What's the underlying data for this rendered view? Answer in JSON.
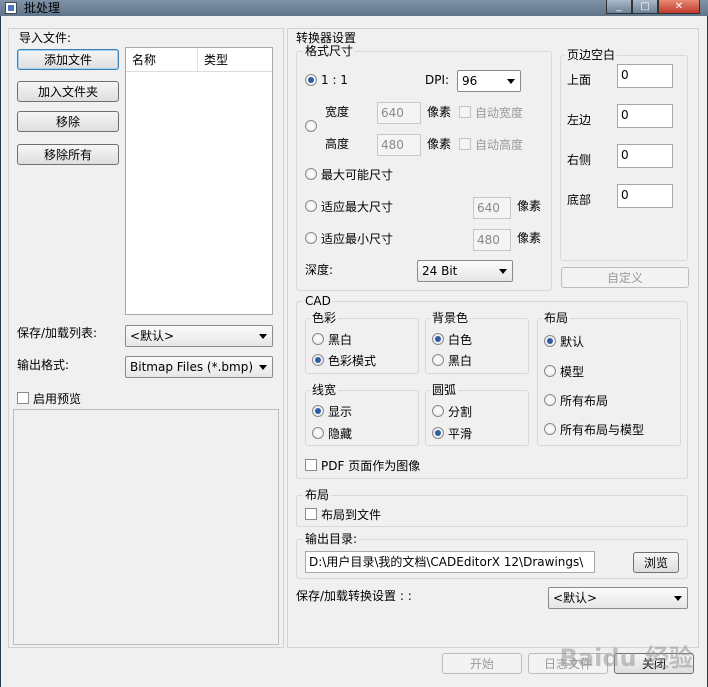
{
  "window": {
    "title": "批处理",
    "minimize": "_",
    "maximize": "□",
    "close": "✕"
  },
  "import": {
    "group_label": "导入文件:",
    "add_file": "添加文件",
    "add_folder": "加入文件夹",
    "remove": "移除",
    "remove_all": "移除所有",
    "columns": [
      "名称",
      "类型"
    ]
  },
  "save_load_list": {
    "label": "保存/加载列表:",
    "value": "<默认>"
  },
  "output_format": {
    "label": "输出格式:",
    "value": "Bitmap Files (*.bmp)"
  },
  "preview": {
    "label": "启用预览"
  },
  "converter": {
    "group_label": "转换器设置",
    "format_size": {
      "group_label": "格式尺寸",
      "one_to_one": "1 : 1",
      "dpi_label": "DPI:",
      "dpi_value": "96",
      "width_label": "宽度",
      "width_value": "640",
      "height_label": "高度",
      "height_value": "480",
      "pixel": "像素",
      "auto_width": "自动宽度",
      "auto_height": "自动高度",
      "max_possible": "最大可能尺寸",
      "fit_max": "适应最大尺寸",
      "fit_max_value": "640",
      "fit_min": "适应最小尺寸",
      "fit_min_value": "480",
      "depth_label": "深度:",
      "depth_value": "24 Bit"
    },
    "margins": {
      "group_label": "页边空白",
      "top_label": "上面",
      "top_value": "0",
      "left_label": "左边",
      "left_value": "0",
      "right_label": "右侧",
      "right_value": "0",
      "bottom_label": "底部",
      "bottom_value": "0",
      "custom_button": "自定义"
    },
    "cad": {
      "group_label": "CAD",
      "color": {
        "label": "色彩",
        "bw": "黑白",
        "color_mode": "色彩模式"
      },
      "background": {
        "label": "背景色",
        "white": "白色",
        "black": "黑白"
      },
      "layout": {
        "label": "布局",
        "default": "默认",
        "model": "模型",
        "all_layouts": "所有布局",
        "all_layouts_model": "所有布局与模型"
      },
      "lineweight": {
        "label": "线宽",
        "show": "显示",
        "hide": "隐藏"
      },
      "arc": {
        "label": "圆弧",
        "split": "分割",
        "smooth": "平滑"
      },
      "pdf_as_image": "PDF 页面作为图像"
    },
    "layout_group": {
      "label": "布局",
      "layout_to_file": "布局到文件"
    },
    "output_dir": {
      "label": "输出目录:",
      "value": "D:\\用户目录\\我的文档\\CADEditorX 12\\Drawings\\",
      "browse": "浏览"
    },
    "save_load_settings": {
      "label": "保存/加载转换设置 : :",
      "value": "<默认>"
    }
  },
  "footer": {
    "start": "开始",
    "log": "日志文件",
    "close": "关闭"
  },
  "watermark": "Baidu 经验"
}
